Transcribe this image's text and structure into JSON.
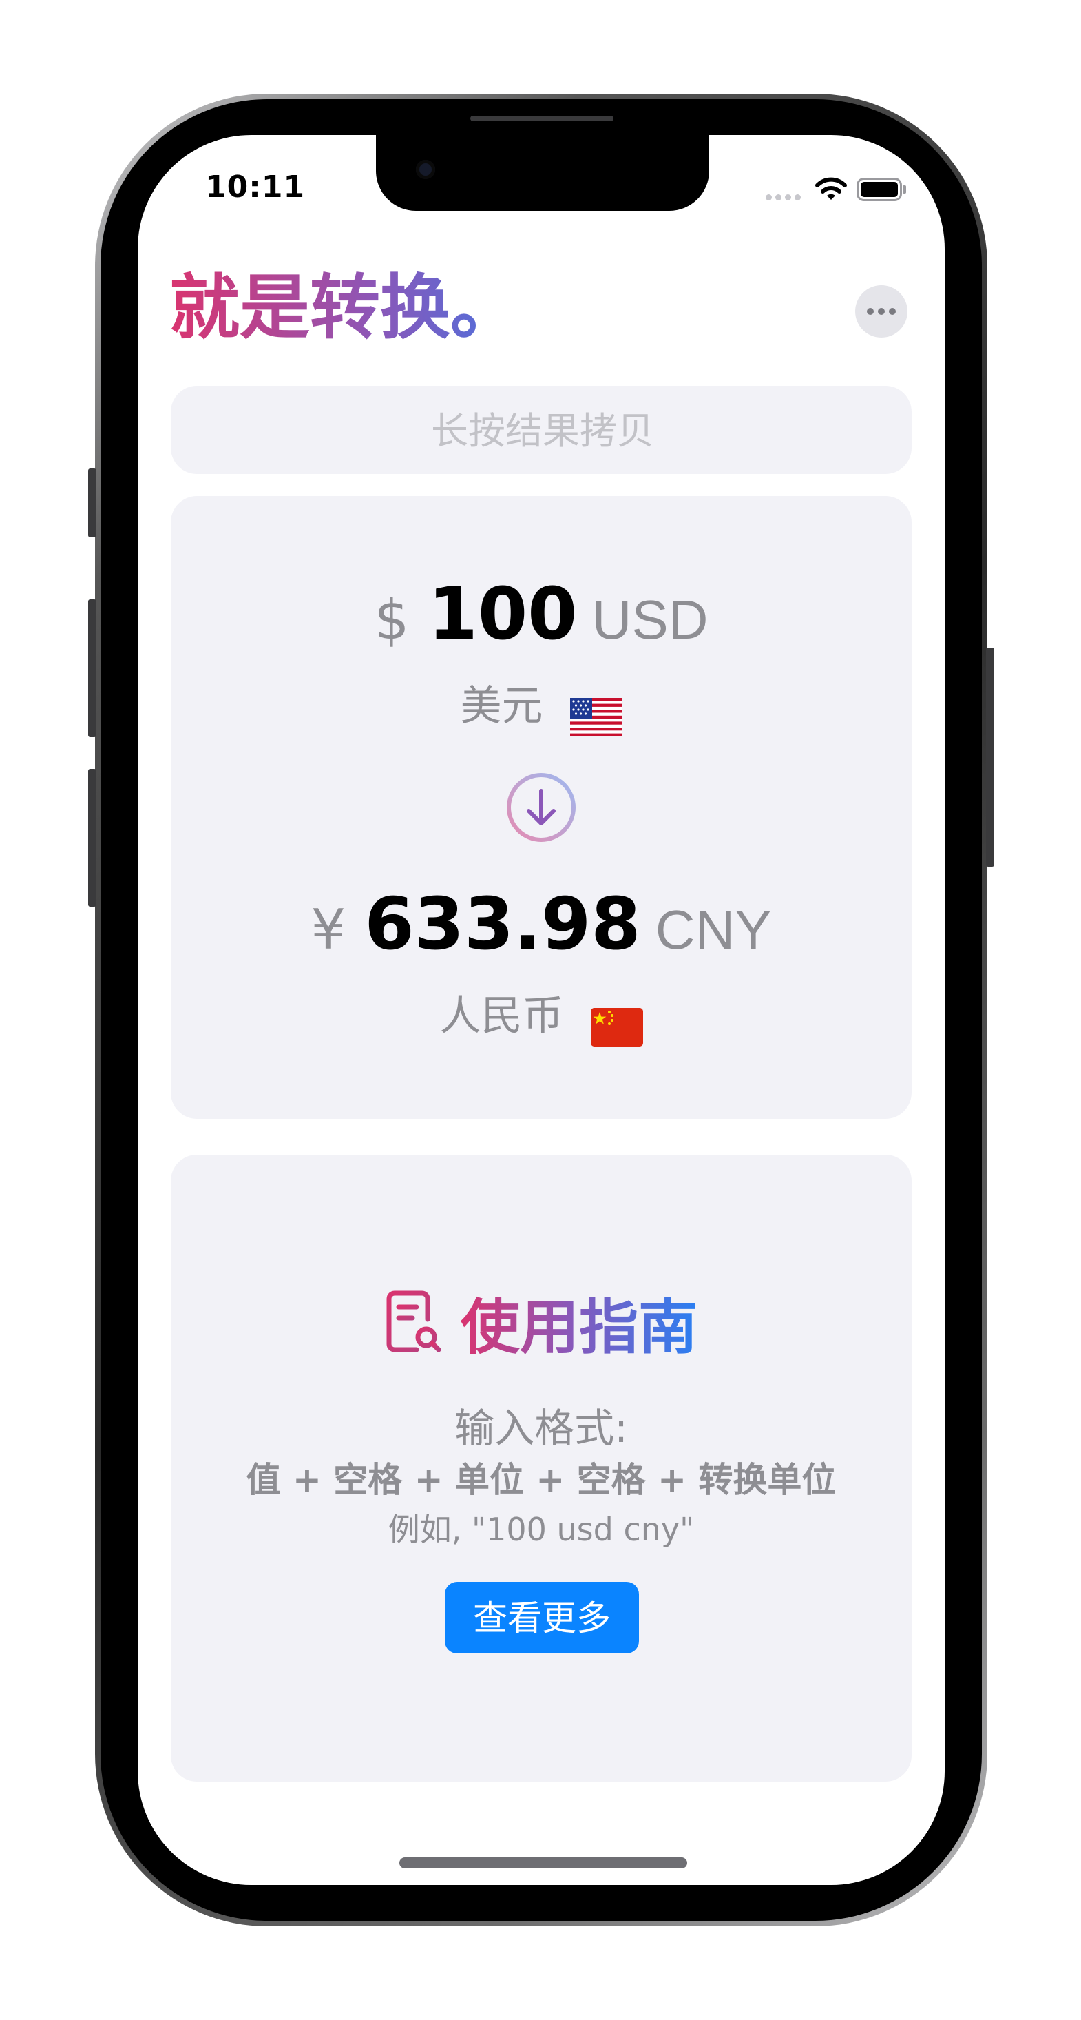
{
  "status_bar": {
    "time": "10:11"
  },
  "header": {
    "title": "就是转换。",
    "more_icon": "ellipsis-icon"
  },
  "search": {
    "placeholder": "长按结果拷贝",
    "value": ""
  },
  "conversion": {
    "from": {
      "symbol": "$",
      "amount": "100",
      "code": "USD",
      "name": "美元",
      "flag": "us-flag-icon"
    },
    "arrow_icon": "arrow-down-circle-icon",
    "to": {
      "symbol": "¥",
      "amount": "633.98",
      "code": "CNY",
      "name": "人民币",
      "flag": "cn-flag-icon"
    }
  },
  "guide": {
    "icon": "document-search-icon",
    "title": "使用指南",
    "format_label": "输入格式:",
    "format_value": "值 + 空格 + 单位 + 空格 + 转换单位",
    "example": "例如, \"100 usd cny\"",
    "more_button": "查看更多"
  },
  "colors": {
    "gradient_start": "#d9346f",
    "gradient_mid": "#8b57b8",
    "gradient_end": "#2a7ff2",
    "accent": "#0a84ff",
    "card_bg": "#f2f2f7"
  }
}
